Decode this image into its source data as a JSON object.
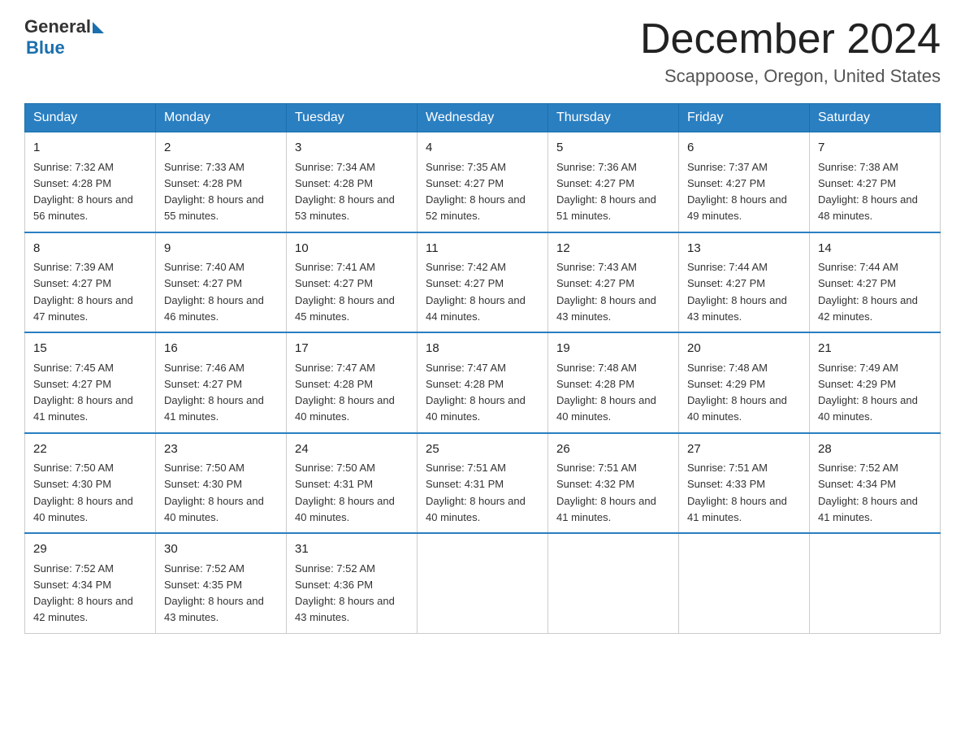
{
  "header": {
    "logo_general": "General",
    "logo_blue": "Blue",
    "title": "December 2024",
    "subtitle": "Scappoose, Oregon, United States"
  },
  "weekdays": [
    "Sunday",
    "Monday",
    "Tuesday",
    "Wednesday",
    "Thursday",
    "Friday",
    "Saturday"
  ],
  "weeks": [
    [
      {
        "day": "1",
        "sunrise": "7:32 AM",
        "sunset": "4:28 PM",
        "daylight": "8 hours and 56 minutes."
      },
      {
        "day": "2",
        "sunrise": "7:33 AM",
        "sunset": "4:28 PM",
        "daylight": "8 hours and 55 minutes."
      },
      {
        "day": "3",
        "sunrise": "7:34 AM",
        "sunset": "4:28 PM",
        "daylight": "8 hours and 53 minutes."
      },
      {
        "day": "4",
        "sunrise": "7:35 AM",
        "sunset": "4:27 PM",
        "daylight": "8 hours and 52 minutes."
      },
      {
        "day": "5",
        "sunrise": "7:36 AM",
        "sunset": "4:27 PM",
        "daylight": "8 hours and 51 minutes."
      },
      {
        "day": "6",
        "sunrise": "7:37 AM",
        "sunset": "4:27 PM",
        "daylight": "8 hours and 49 minutes."
      },
      {
        "day": "7",
        "sunrise": "7:38 AM",
        "sunset": "4:27 PM",
        "daylight": "8 hours and 48 minutes."
      }
    ],
    [
      {
        "day": "8",
        "sunrise": "7:39 AM",
        "sunset": "4:27 PM",
        "daylight": "8 hours and 47 minutes."
      },
      {
        "day": "9",
        "sunrise": "7:40 AM",
        "sunset": "4:27 PM",
        "daylight": "8 hours and 46 minutes."
      },
      {
        "day": "10",
        "sunrise": "7:41 AM",
        "sunset": "4:27 PM",
        "daylight": "8 hours and 45 minutes."
      },
      {
        "day": "11",
        "sunrise": "7:42 AM",
        "sunset": "4:27 PM",
        "daylight": "8 hours and 44 minutes."
      },
      {
        "day": "12",
        "sunrise": "7:43 AM",
        "sunset": "4:27 PM",
        "daylight": "8 hours and 43 minutes."
      },
      {
        "day": "13",
        "sunrise": "7:44 AM",
        "sunset": "4:27 PM",
        "daylight": "8 hours and 43 minutes."
      },
      {
        "day": "14",
        "sunrise": "7:44 AM",
        "sunset": "4:27 PM",
        "daylight": "8 hours and 42 minutes."
      }
    ],
    [
      {
        "day": "15",
        "sunrise": "7:45 AM",
        "sunset": "4:27 PM",
        "daylight": "8 hours and 41 minutes."
      },
      {
        "day": "16",
        "sunrise": "7:46 AM",
        "sunset": "4:27 PM",
        "daylight": "8 hours and 41 minutes."
      },
      {
        "day": "17",
        "sunrise": "7:47 AM",
        "sunset": "4:28 PM",
        "daylight": "8 hours and 40 minutes."
      },
      {
        "day": "18",
        "sunrise": "7:47 AM",
        "sunset": "4:28 PM",
        "daylight": "8 hours and 40 minutes."
      },
      {
        "day": "19",
        "sunrise": "7:48 AM",
        "sunset": "4:28 PM",
        "daylight": "8 hours and 40 minutes."
      },
      {
        "day": "20",
        "sunrise": "7:48 AM",
        "sunset": "4:29 PM",
        "daylight": "8 hours and 40 minutes."
      },
      {
        "day": "21",
        "sunrise": "7:49 AM",
        "sunset": "4:29 PM",
        "daylight": "8 hours and 40 minutes."
      }
    ],
    [
      {
        "day": "22",
        "sunrise": "7:50 AM",
        "sunset": "4:30 PM",
        "daylight": "8 hours and 40 minutes."
      },
      {
        "day": "23",
        "sunrise": "7:50 AM",
        "sunset": "4:30 PM",
        "daylight": "8 hours and 40 minutes."
      },
      {
        "day": "24",
        "sunrise": "7:50 AM",
        "sunset": "4:31 PM",
        "daylight": "8 hours and 40 minutes."
      },
      {
        "day": "25",
        "sunrise": "7:51 AM",
        "sunset": "4:31 PM",
        "daylight": "8 hours and 40 minutes."
      },
      {
        "day": "26",
        "sunrise": "7:51 AM",
        "sunset": "4:32 PM",
        "daylight": "8 hours and 41 minutes."
      },
      {
        "day": "27",
        "sunrise": "7:51 AM",
        "sunset": "4:33 PM",
        "daylight": "8 hours and 41 minutes."
      },
      {
        "day": "28",
        "sunrise": "7:52 AM",
        "sunset": "4:34 PM",
        "daylight": "8 hours and 41 minutes."
      }
    ],
    [
      {
        "day": "29",
        "sunrise": "7:52 AM",
        "sunset": "4:34 PM",
        "daylight": "8 hours and 42 minutes."
      },
      {
        "day": "30",
        "sunrise": "7:52 AM",
        "sunset": "4:35 PM",
        "daylight": "8 hours and 43 minutes."
      },
      {
        "day": "31",
        "sunrise": "7:52 AM",
        "sunset": "4:36 PM",
        "daylight": "8 hours and 43 minutes."
      },
      null,
      null,
      null,
      null
    ]
  ]
}
